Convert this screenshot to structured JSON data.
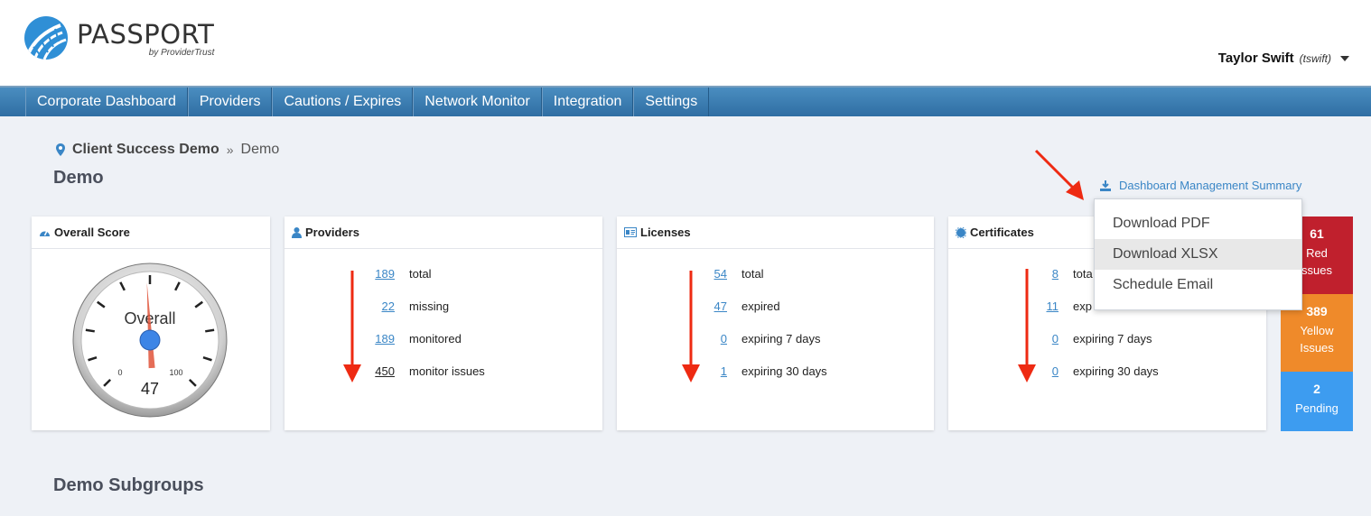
{
  "app": {
    "title": "PASSPORT",
    "subtitle": "by ProviderTrust"
  },
  "user": {
    "name": "Taylor Swift",
    "handle": "(tswift)"
  },
  "nav": {
    "items": [
      {
        "label": "Corporate Dashboard"
      },
      {
        "label": "Providers"
      },
      {
        "label": "Cautions / Expires"
      },
      {
        "label": "Network Monitor"
      },
      {
        "label": "Integration"
      },
      {
        "label": "Settings"
      }
    ]
  },
  "breadcrumb": {
    "client": "Client Success Demo",
    "current": "Demo"
  },
  "page": {
    "title": "Demo",
    "subgroups_title": "Demo Subgroups"
  },
  "dashboard_link": {
    "label": "Dashboard Management Summary"
  },
  "dropdown": {
    "items": [
      {
        "label": "Download PDF"
      },
      {
        "label": "Download XLSX"
      },
      {
        "label": "Schedule Email"
      }
    ]
  },
  "overall": {
    "title": "Overall Score",
    "gauge_label": "Overall",
    "min": "0",
    "max": "100",
    "score": "47"
  },
  "providers": {
    "title": "Providers",
    "stats": [
      {
        "value": "189",
        "label": "total"
      },
      {
        "value": "22",
        "label": "missing"
      },
      {
        "value": "189",
        "label": "monitored"
      },
      {
        "value": "450",
        "label": "monitor issues"
      }
    ]
  },
  "licenses": {
    "title": "Licenses",
    "stats": [
      {
        "value": "54",
        "label": "total"
      },
      {
        "value": "47",
        "label": "expired"
      },
      {
        "value": "0",
        "label": "expiring 7 days"
      },
      {
        "value": "1",
        "label": "expiring 30 days"
      }
    ]
  },
  "certificates": {
    "title": "Certificates",
    "stats": [
      {
        "value": "8",
        "label": "tota"
      },
      {
        "value": "11",
        "label": "exp"
      },
      {
        "value": "0",
        "label": "expiring 7 days"
      },
      {
        "value": "0",
        "label": "expiring 30 days"
      }
    ]
  },
  "status": {
    "red": {
      "count": "61",
      "line1": "Red",
      "line2": "ssues",
      "color": "#c0202d"
    },
    "yellow": {
      "count": "389",
      "line1": "Yellow",
      "line2": "Issues",
      "color": "#ef8a2a"
    },
    "pending": {
      "count": "2",
      "line1": "Pending",
      "color": "#3d9cf0"
    }
  },
  "colors": {
    "arrow": "#ee2a12",
    "link": "#3a86c6",
    "nav": "#3a78ad"
  },
  "icons": [
    "logo-icon",
    "caret-down-icon",
    "map-pin-icon",
    "download-icon",
    "gauge-icon",
    "user-icon",
    "id-card-icon",
    "certificate-icon",
    "red-arrow-icon"
  ]
}
